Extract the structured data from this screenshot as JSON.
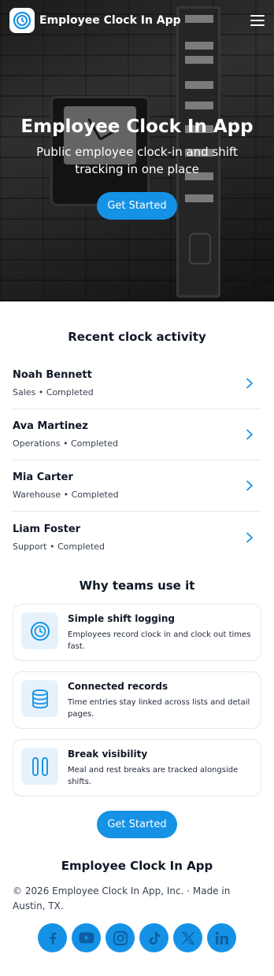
{
  "header": {
    "brand": "Employee Clock In App",
    "menu_icon": "hamburger-icon"
  },
  "hero": {
    "title": "Employee Clock In App",
    "subtitle": "Public employee clock-in and shift tracking in one place",
    "cta_label": "Get Started"
  },
  "activity": {
    "title": "Recent clock activity",
    "items": [
      {
        "name": "Noah Bennett",
        "meta": "Sales • Completed"
      },
      {
        "name": "Ava Martinez",
        "meta": "Operations • Completed"
      },
      {
        "name": "Mia Carter",
        "meta": "Warehouse • Completed"
      },
      {
        "name": "Liam Foster",
        "meta": "Support • Completed"
      }
    ]
  },
  "why": {
    "title": "Why teams use it",
    "features": [
      {
        "icon": "clock-icon",
        "title": "Simple shift logging",
        "desc": "Employees record clock in and clock out times fast."
      },
      {
        "icon": "database-icon",
        "title": "Connected records",
        "desc": "Time entries stay linked across lists and detail pages."
      },
      {
        "icon": "pause-icon",
        "title": "Break visibility",
        "desc": "Meal and rest breaks are tracked alongside shifts."
      }
    ]
  },
  "cta": {
    "label": "Get Started"
  },
  "footer": {
    "title": "Employee Clock In App",
    "copyright": "© 2026 Employee Clock In App, Inc. · Made in Austin, TX.",
    "socials": [
      "facebook-icon",
      "youtube-icon",
      "instagram-icon",
      "tiktok-icon",
      "x-icon",
      "linkedin-icon"
    ]
  },
  "colors": {
    "accent": "#1592e6",
    "icon_bg": "#e6f2fb",
    "text": "#111827"
  }
}
